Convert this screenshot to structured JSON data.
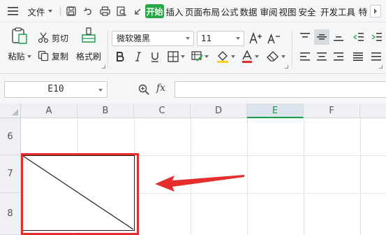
{
  "menubar": {
    "file_label": "文件",
    "tabs": [
      {
        "label": "开始",
        "active": true
      },
      {
        "label": "插入"
      },
      {
        "label": "页面布局"
      },
      {
        "label": "公式"
      },
      {
        "label": "数据"
      },
      {
        "label": "审阅"
      },
      {
        "label": "视图"
      },
      {
        "label": "安全"
      },
      {
        "label": "开发工具"
      },
      {
        "label": "特"
      }
    ]
  },
  "ribbon": {
    "paste_label": "粘贴",
    "cut_label": "剪切",
    "copy_label": "复制",
    "format_painter_label": "格式刷",
    "font_name": "微软雅黑",
    "font_size": "11",
    "accent_color": "#27a745"
  },
  "formula_bar": {
    "name_box": "E10",
    "fx_label": "fx"
  },
  "sheet": {
    "columns": [
      "A",
      "B",
      "C",
      "D",
      "E",
      "F"
    ],
    "selected_column": "E",
    "rows": [
      "6",
      "7",
      "8"
    ],
    "annotation_color": "#e52d2d"
  }
}
